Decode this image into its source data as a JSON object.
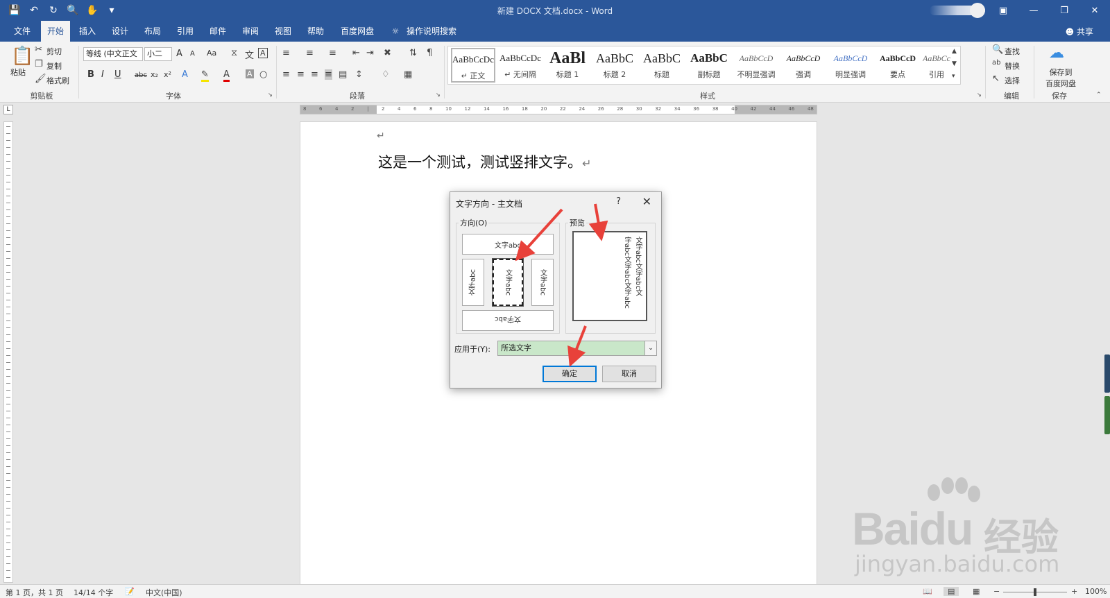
{
  "colors": {
    "brand": "#2b579a",
    "ribbon_bg": "#f3f3f3",
    "apply_select_bg": "#c9e7c9",
    "annotation_arrow": "#e8413a"
  },
  "titlebar": {
    "title": "新建 DOCX 文档.docx  -  Word",
    "qat_icons": [
      "save-icon",
      "undo-icon",
      "redo-icon",
      "print-preview-icon",
      "touch-mode-icon",
      "customize-icon"
    ]
  },
  "tabs": {
    "items": [
      "文件",
      "开始",
      "插入",
      "设计",
      "布局",
      "引用",
      "邮件",
      "审阅",
      "视图",
      "帮助",
      "百度网盘"
    ],
    "active_index": 1,
    "tell_me": "操作说明搜索",
    "share": "共享"
  },
  "ribbon": {
    "clipboard": {
      "paste": "粘贴",
      "cut": "剪切",
      "copy": "复制",
      "format_painter": "格式刷",
      "label": "剪贴板"
    },
    "font": {
      "font_name": "等线 (中文正文",
      "font_size": "小二",
      "grow": "A",
      "shrink": "A",
      "case": "Aa",
      "bold": "B",
      "italic": "I",
      "underline": "U",
      "strike": "abc",
      "sub": "x₂",
      "sup": "x²",
      "label": "字体"
    },
    "paragraph": {
      "label": "段落"
    },
    "styles": {
      "items": [
        {
          "sample": "AaBbCcDc",
          "name": "↵ 正文"
        },
        {
          "sample": "AaBbCcDc",
          "name": "↵ 无间隔"
        },
        {
          "sample": "AaBl",
          "name": "标题 1"
        },
        {
          "sample": "AaBbC",
          "name": "标题 2"
        },
        {
          "sample": "AaBbC",
          "name": "标题"
        },
        {
          "sample": "AaBbC",
          "name": "副标题"
        },
        {
          "sample": "AaBbCcD",
          "name": "不明显强调"
        },
        {
          "sample": "AaBbCcD",
          "name": "强调"
        },
        {
          "sample": "AaBbCcD",
          "name": "明显强调"
        },
        {
          "sample": "AaBbCcD",
          "name": "要点"
        },
        {
          "sample": "AaBbCcD",
          "name": "引用"
        }
      ],
      "label": "样式"
    },
    "editing": {
      "find": "查找",
      "replace": "替换",
      "select": "选择",
      "label": "编辑"
    },
    "save": {
      "button": "保存到\n百度网盘",
      "line1": "保存到",
      "line2": "百度网盘",
      "label": "保存"
    }
  },
  "ruler": {
    "ticks": [
      "8",
      "6",
      "4",
      "2",
      "",
      "2",
      "4",
      "6",
      "8",
      "10",
      "12",
      "14",
      "16",
      "18",
      "20",
      "22",
      "24",
      "26",
      "28",
      "30",
      "32",
      "34",
      "36",
      "38",
      "40",
      "42",
      "44",
      "46",
      "48"
    ]
  },
  "document": {
    "empty_para_mark": "↵",
    "text": "这是一个测试，测试竖排文字。",
    "para_mark": "↵"
  },
  "dialog": {
    "title": "文字方向 - 主文档",
    "help": "?",
    "close": "✕",
    "orientation_label": "方向(O)",
    "preview_label": "预览",
    "options": {
      "horizontal": "文字abc",
      "left_vertical": "文字abc",
      "stacked": "文字abc",
      "right_vertical": "文字abc",
      "upside_down": "文字abc"
    },
    "preview_lines": [
      "文字abc文字abc文",
      "字abc文字abc文字abc"
    ],
    "apply_label": "应用于(Y):",
    "apply_value": "所选文字",
    "ok": "确定",
    "cancel": "取消"
  },
  "statusbar": {
    "page": "第 1 页，共 1 页",
    "words": "14/14 个字",
    "language": "中文(中国)",
    "zoom": "100%"
  },
  "watermark": {
    "brand": "Bai",
    "brand2": "du",
    "cn": "经验",
    "url": "jingyan.baidu.com"
  }
}
